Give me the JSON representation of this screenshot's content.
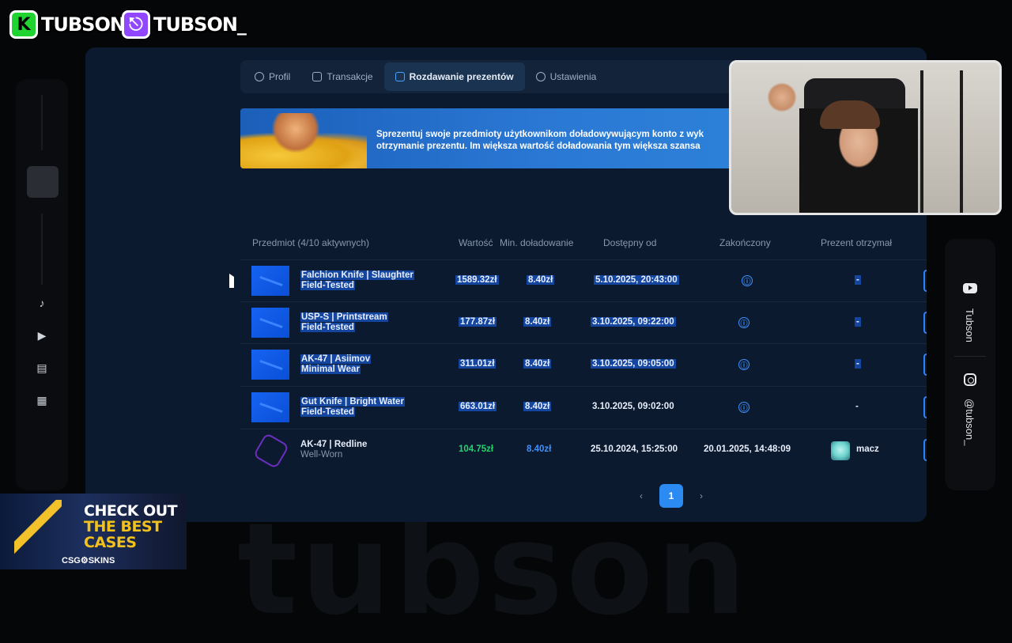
{
  "overlay": {
    "kick_name": "TUBSON",
    "twitch_name": "TUBSON_",
    "bg_word": "tubson",
    "social_youtube": "Tubson",
    "social_instagram": "@tubson_",
    "promo_line1": "CHECK OUT",
    "promo_line2": "THE BEST",
    "promo_line3": "CASES",
    "promo_brand": "CSG⚙SKINS"
  },
  "tabs": [
    {
      "label": "Profil",
      "icon": "user-icon"
    },
    {
      "label": "Transakcje",
      "icon": "wallet-icon"
    },
    {
      "label": "Rozdawanie prezentów",
      "icon": "gift-icon",
      "active": true
    },
    {
      "label": "Ustawienia",
      "icon": "gear-icon"
    }
  ],
  "banner": {
    "line1": "Sprezentuj swoje przedmioty użytkownikom doładowywującym konto z wyk",
    "line2": "otrzymanie prezentu. Im większa wartość doładowania tym większa szansa"
  },
  "table": {
    "headers": {
      "item": "Przedmiot (4/10 aktywnych)",
      "value": "Wartość",
      "min_topup": "Min. doładowanie",
      "available": "Dostępny od",
      "ended": "Zakończony",
      "recipient": "Prezent otrzymał"
    },
    "rows": [
      {
        "name": "Falchion Knife | Slaughter",
        "wear": "Field-Tested",
        "value": "1589.32zł",
        "min": "8.40zł",
        "available": "5.10.2025, 20:43:00",
        "ended": "ⓘ",
        "recipient": "-"
      },
      {
        "name": "USP-S | Printstream",
        "wear": "Field-Tested",
        "value": "177.87zł",
        "min": "8.40zł",
        "available": "3.10.2025, 09:22:00",
        "ended": "ⓘ",
        "recipient": "-"
      },
      {
        "name": "AK-47 | Asiimov",
        "wear": "Minimal Wear",
        "value": "311.01zł",
        "min": "8.40zł",
        "available": "3.10.2025, 09:05:00",
        "ended": "ⓘ",
        "recipient": "-"
      },
      {
        "name": "Gut Knife | Bright Water",
        "wear": "Field-Tested",
        "value": "663.01zł",
        "min": "8.40zł",
        "available": "3.10.2025, 09:02:00",
        "ended": "ⓘ",
        "recipient": "-"
      },
      {
        "name": "AK-47 | Redline",
        "wear": "Well-Worn",
        "value": "104.75zł",
        "min": "8.40zł",
        "available": "25.10.2024, 15:25:00",
        "ended": "20.01.2025, 14:48:09",
        "recipient": "macz"
      }
    ]
  },
  "pagination": {
    "prev": "‹",
    "current": "1",
    "next": "›"
  },
  "colors": {
    "accent": "#2b8bf2",
    "value_green": "#23d46b",
    "selection": "#1446a0",
    "kick": "#1fd430",
    "twitch": "#9146ff"
  }
}
